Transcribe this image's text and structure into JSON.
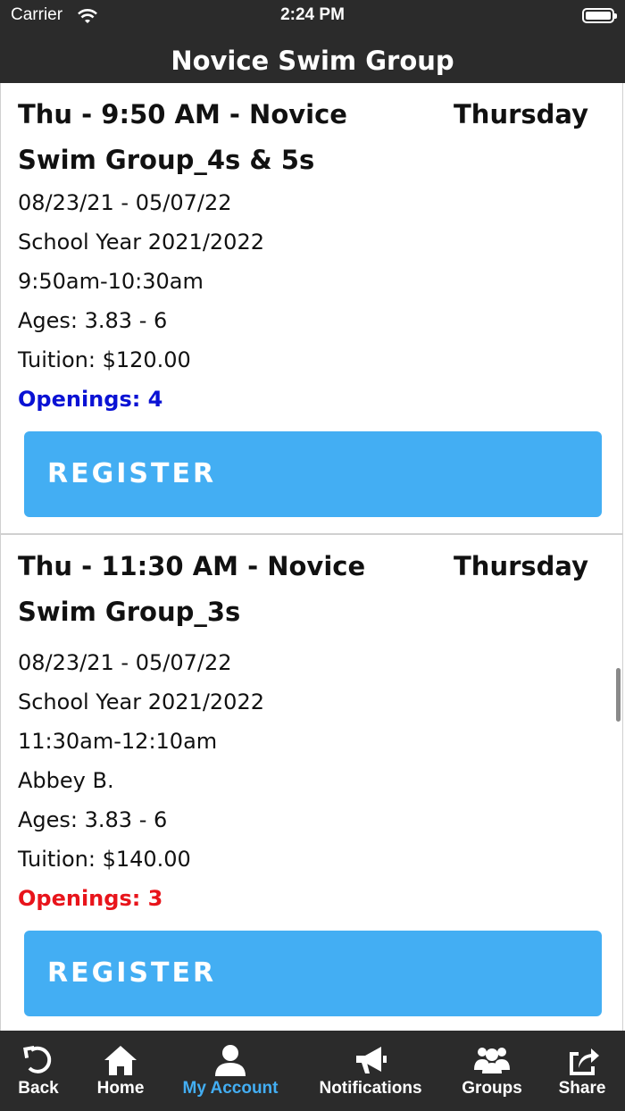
{
  "status_bar": {
    "carrier": "Carrier",
    "time": "2:24 PM"
  },
  "header": {
    "title": "Novice Swim Group"
  },
  "classes": [
    {
      "title": "Thu - 9:50 AM - Novice Swim Group_4s & 5s",
      "day": "Thursday",
      "details": [
        "08/23/21 - 05/07/22",
        "School Year 2021/2022",
        "9:50am-10:30am",
        "Ages: 3.83 - 6",
        "Tuition: $120.00"
      ],
      "openings": "Openings: 4",
      "openings_color": "#0a12d4",
      "register_label": "REGISTER"
    },
    {
      "title": "Thu - 11:30 AM - Novice Swim Group_3s",
      "day": "Thursday",
      "details": [
        "08/23/21 - 05/07/22",
        "School Year 2021/2022",
        "11:30am-12:10am",
        "Abbey B.",
        "Ages: 3.83 - 6",
        "Tuition: $140.00"
      ],
      "openings": "Openings: 3",
      "openings_color": "#e8141b",
      "register_label": "REGISTER"
    }
  ],
  "tab_bar": {
    "items": [
      {
        "label": "Back",
        "icon": "back-arrow-icon"
      },
      {
        "label": "Home",
        "icon": "home-icon"
      },
      {
        "label": "My Account",
        "icon": "user-icon",
        "active": true
      },
      {
        "label": "Notifications",
        "icon": "megaphone-icon"
      },
      {
        "label": "Groups",
        "icon": "group-icon"
      },
      {
        "label": "Share",
        "icon": "share-icon"
      }
    ]
  },
  "colors": {
    "accent": "#43aef3",
    "bar_background": "#2b2b2b"
  }
}
